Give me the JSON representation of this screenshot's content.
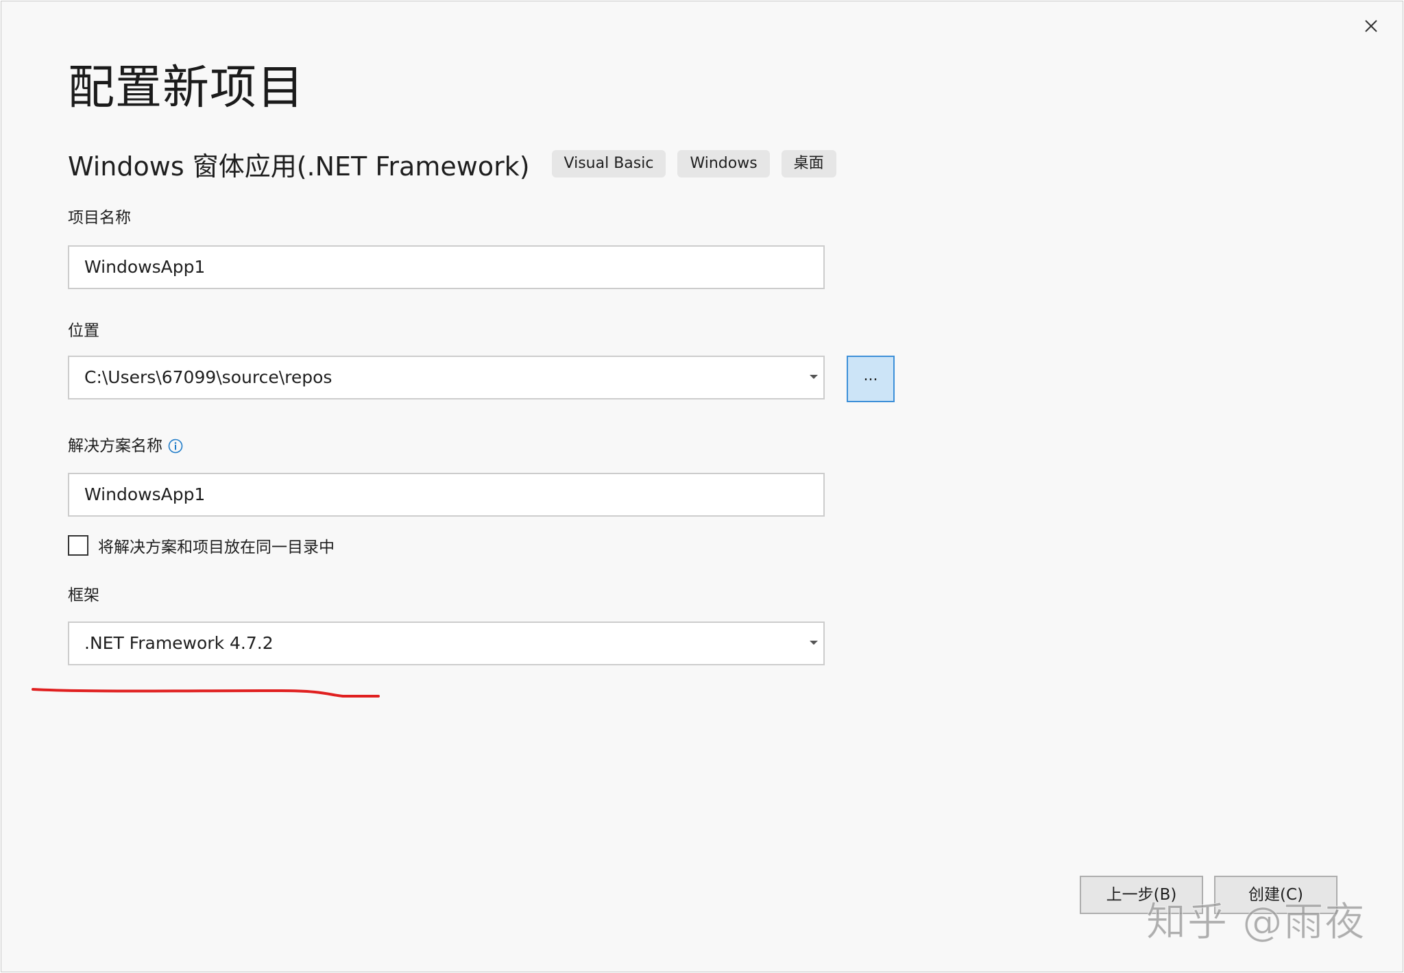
{
  "dialog": {
    "title": "配置新项目",
    "close_icon": "close-icon"
  },
  "template": {
    "name": "Windows 窗体应用(.NET Framework)",
    "tags": [
      "Visual Basic",
      "Windows",
      "桌面"
    ]
  },
  "project_name": {
    "label": "项目名称",
    "value": "WindowsApp1"
  },
  "location": {
    "label": "位置",
    "value": "C:\\Users\\67099\\source\\repos",
    "browse_label": "..."
  },
  "solution_name": {
    "label": "解决方案名称",
    "value": "WindowsApp1",
    "info_icon": "info-icon"
  },
  "same_directory": {
    "label": "将解决方案和项目放在同一目录中",
    "checked": false
  },
  "framework": {
    "label": "框架",
    "value": ".NET Framework 4.7.2"
  },
  "footer": {
    "back_label": "上一步(B)",
    "create_label": "创建(C)"
  },
  "watermark": "知乎 @雨夜",
  "colors": {
    "accent_button_bg": "#cce4f7",
    "accent_button_border": "#3c8fd8",
    "annotation": "#e02020"
  }
}
